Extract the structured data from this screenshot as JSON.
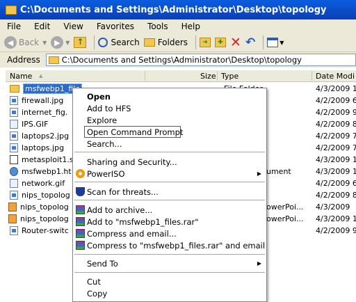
{
  "window": {
    "title": "C:\\Documents and Settings\\Administrator\\Desktop\\topology"
  },
  "menu": [
    "File",
    "Edit",
    "View",
    "Favorites",
    "Tools",
    "Help"
  ],
  "toolbar": {
    "back": "Back",
    "search": "Search",
    "folders": "Folders"
  },
  "address": {
    "label": "Address",
    "value": "C:\\Documents and Settings\\Administrator\\Desktop\\topology"
  },
  "columns": {
    "name": "Name",
    "size": "Size",
    "type": "Type",
    "date": "Date Modi"
  },
  "files": [
    {
      "name": "msfwebp1_file",
      "type": "File Folder",
      "date": "4/3/2009 1",
      "icon": "folder-icon"
    },
    {
      "name": "firewall.jpg",
      "type": "",
      "date": "4/2/2009 6",
      "icon": "image-file-icon"
    },
    {
      "name": "internet_fig.",
      "type": "",
      "date": "4/2/2009 9",
      "icon": "image-file-icon"
    },
    {
      "name": "IPS.GIF",
      "type": "",
      "date": "4/2/2009 8",
      "icon": "gif-file-icon"
    },
    {
      "name": "laptops2.jpg",
      "type": "",
      "date": "4/2/2009 7",
      "icon": "image-file-icon"
    },
    {
      "name": "laptops.jpg",
      "type": "",
      "date": "4/2/2009 7",
      "icon": "image-file-icon"
    },
    {
      "name": "metasploit1.s",
      "type": "",
      "date": "4/3/2009 1",
      "icon": "exe-file-icon"
    },
    {
      "name": "msfwebp1.ht",
      "type": "ument",
      "date": "4/3/2009 1",
      "icon": "html-file-icon"
    },
    {
      "name": "network.gif",
      "type": "",
      "date": "4/2/2009 6",
      "icon": "gif-file-icon"
    },
    {
      "name": "nips_topolog",
      "type": "",
      "date": "4/2/2009 8",
      "icon": "image-file-icon"
    },
    {
      "name": "nips_topolog",
      "type": "owerPoi...",
      "date": "4/3/2009",
      "icon": "ppt-file-icon"
    },
    {
      "name": "nips_topolog",
      "type": "owerPoi...",
      "date": "4/3/2009 1",
      "icon": "ppt-file-icon"
    },
    {
      "name": "Router-switc",
      "type": "",
      "date": "4/2/2009 9",
      "icon": "image-file-icon"
    }
  ],
  "context_menu": {
    "open": "Open",
    "add_to_hfs": "Add to HFS",
    "explore": "Explore",
    "open_cmd": "Open Command Prompt",
    "search": "Search...",
    "sharing": "Sharing and Security...",
    "poweriso": "PowerISO",
    "scan": "Scan for threats...",
    "add_archive": "Add to archive...",
    "add_rar": "Add to \"msfwebp1_files.rar\"",
    "compress_email": "Compress and email...",
    "compress_rar_email": "Compress to \"msfwebp1_files.rar\" and email",
    "send_to": "Send To",
    "cut": "Cut",
    "copy": "Copy"
  }
}
